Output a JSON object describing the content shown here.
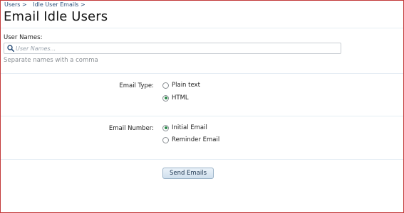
{
  "breadcrumb": {
    "items": [
      "Users >",
      "Idle User Emails >"
    ]
  },
  "page": {
    "title": "Email Idle Users"
  },
  "form": {
    "user_names": {
      "label": "User Names:",
      "placeholder": "User Names...",
      "value": "",
      "hint": "Separate names with a comma"
    },
    "email_type": {
      "label": "Email Type:",
      "options": [
        {
          "label": "Plain text",
          "selected": false
        },
        {
          "label": "HTML",
          "selected": true
        }
      ]
    },
    "email_number": {
      "label": "Email Number:",
      "options": [
        {
          "label": "Initial Email",
          "selected": true
        },
        {
          "label": "Reminder Email",
          "selected": false
        }
      ]
    },
    "submit_label": "Send Emails"
  },
  "colors": {
    "frame_border": "#c33a3a",
    "link": "#2a4f7a",
    "radio_selected": "#2b8a4b",
    "button_bg": "#cfdfed"
  }
}
